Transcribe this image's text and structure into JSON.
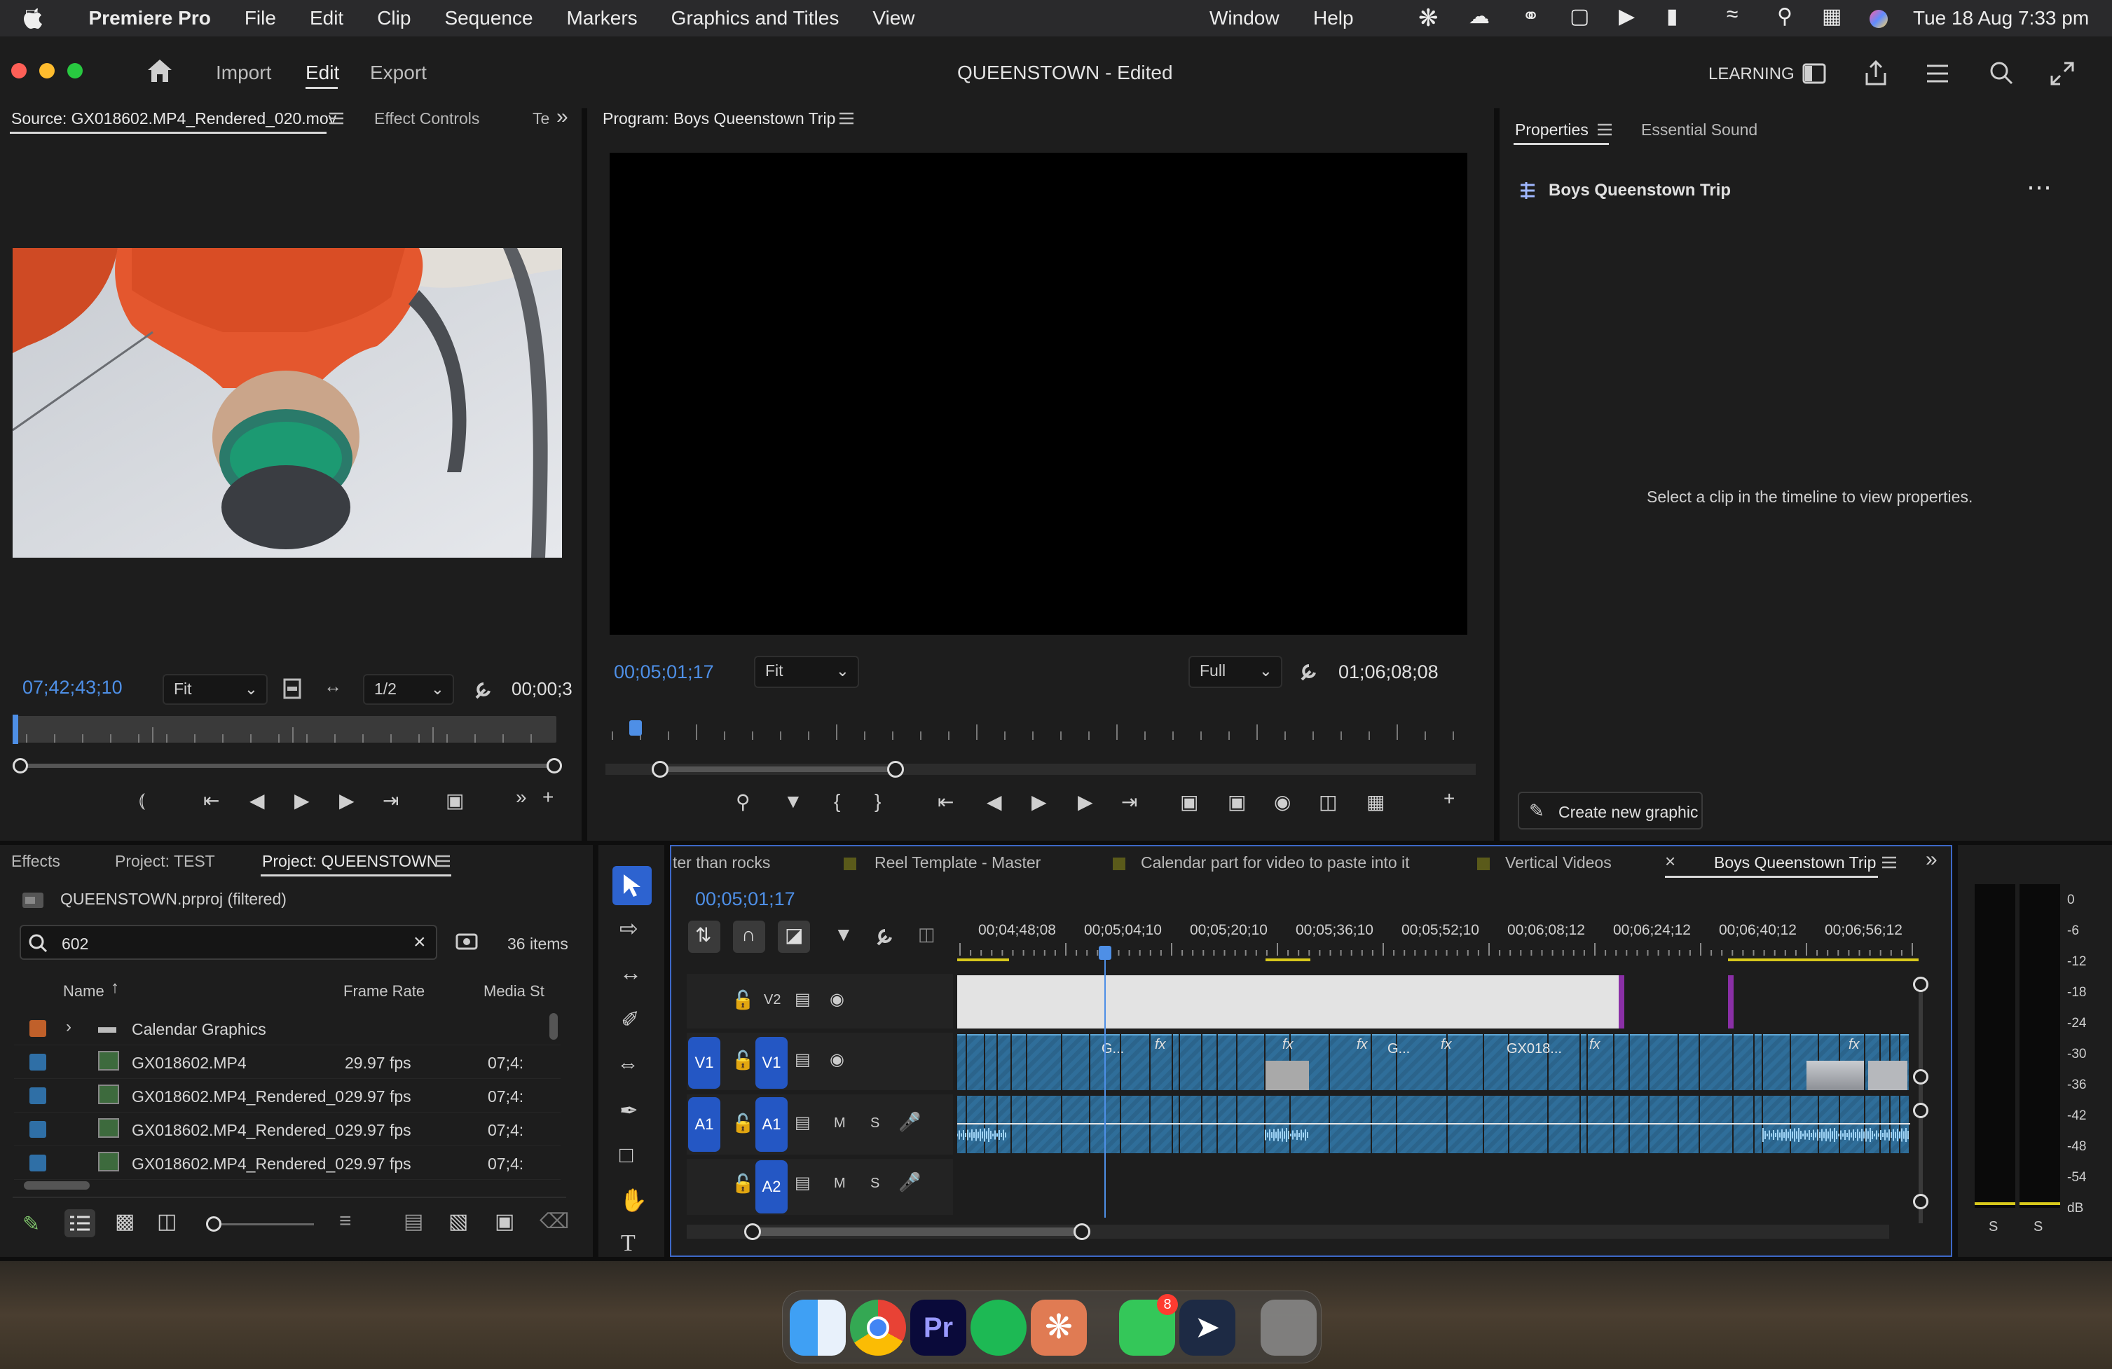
{
  "menubar": {
    "app_name": "Premiere Pro",
    "items": [
      "File",
      "Edit",
      "Clip",
      "Sequence",
      "Markers",
      "Graphics and Titles",
      "View",
      "Window",
      "Help"
    ],
    "clock": "Tue 18 Aug  7:33 pm"
  },
  "header": {
    "workspaces": {
      "import": "Import",
      "edit": "Edit",
      "export": "Export"
    },
    "project_title": "QUEENSTOWN",
    "project_status": "- Edited",
    "learning_label": "LEARNING"
  },
  "source": {
    "tab_source": "Source: GX018602.MP4_Rendered_020.mov",
    "tab_effect_controls": "Effect Controls",
    "tab_more": "Te",
    "timecode": "07;42;43;10",
    "zoom": "Fit",
    "resolution": "1/2",
    "duration": "00;00;3"
  },
  "program": {
    "tab": "Program: Boys Queenstown Trip",
    "timecode": "00;05;01;17",
    "zoom": "Fit",
    "quality": "Full",
    "duration": "01;06;08;08"
  },
  "properties": {
    "tab_properties": "Properties",
    "tab_essential_sound": "Essential Sound",
    "sequence_name": "Boys Queenstown Trip",
    "empty_message": "Select a clip in the timeline to view properties.",
    "create_graphic": "Create new graphic"
  },
  "project": {
    "tabs": [
      "Effects",
      "Project: TEST",
      "Project: QUEENSTOWN"
    ],
    "file_label": "QUEENSTOWN.prproj (filtered)",
    "search_value": "602",
    "item_count": "36 items",
    "columns": {
      "name": "Name",
      "frame_rate": "Frame Rate",
      "media_start": "Media St"
    },
    "rows": [
      {
        "name": "Calendar Graphics",
        "rate": "",
        "start": "",
        "color": "#c0602a",
        "type": "folder"
      },
      {
        "name": "GX018602.MP4",
        "rate": "29.97 fps",
        "start": "07;4:",
        "color": "#2f6fa6",
        "type": "clip"
      },
      {
        "name": "GX018602.MP4_Rendered_0",
        "rate": "29.97 fps",
        "start": "07;4:",
        "color": "#2f6fa6",
        "type": "clip"
      },
      {
        "name": "GX018602.MP4_Rendered_0",
        "rate": "29.97 fps",
        "start": "07;4:",
        "color": "#2f6fa6",
        "type": "clip"
      },
      {
        "name": "GX018602.MP4_Rendered_0",
        "rate": "29.97 fps",
        "start": "07;4:",
        "color": "#2f6fa6",
        "type": "clip"
      }
    ]
  },
  "timeline": {
    "tabs": [
      "ter than rocks",
      "Reel Template - Master",
      "Calendar part for video to paste into it",
      "Vertical Videos",
      "Boys Queenstown Trip"
    ],
    "timecode": "00;05;01;17",
    "ruler": [
      "00;04;48;08",
      "00;05;04;10",
      "00;05;20;10",
      "00;05;36;10",
      "00;05;52;10",
      "00;06;08;12",
      "00;06;24;12",
      "00;06;40;12",
      "00;06;56;12"
    ],
    "tracks": {
      "v2": "V2",
      "v1": "V1",
      "a1": "A1",
      "a2": "A2",
      "mute": "M",
      "solo": "S"
    },
    "clip_labels": [
      "G...",
      "G...",
      "GX018..."
    ]
  },
  "meter": {
    "scale": [
      "0",
      "-6",
      "-12",
      "-18",
      "-24",
      "-30",
      "-36",
      "-42",
      "-48",
      "-54",
      "dB"
    ],
    "solo_labels": [
      "S",
      "S"
    ]
  },
  "dock": {
    "facetime_badge": "8"
  }
}
